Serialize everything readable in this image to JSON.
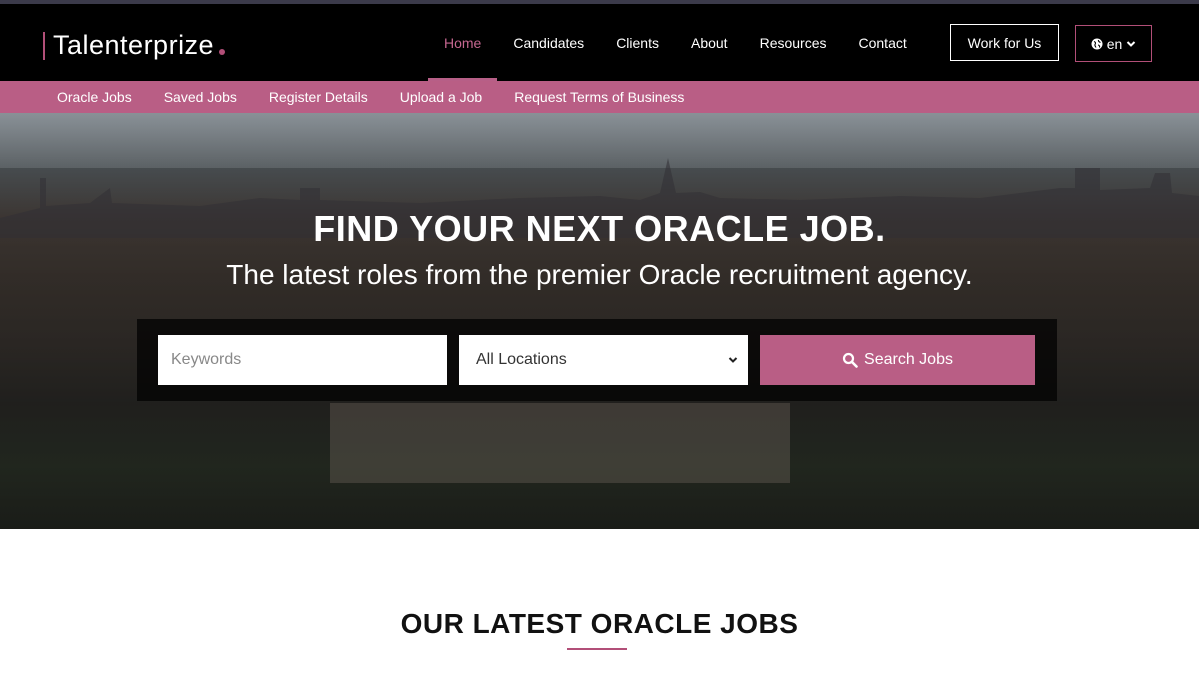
{
  "brand": {
    "name": "Talenterprize",
    "accent": "#b24f78"
  },
  "nav": {
    "items": [
      {
        "label": "Home",
        "active": true
      },
      {
        "label": "Candidates"
      },
      {
        "label": "Clients"
      },
      {
        "label": "About"
      },
      {
        "label": "Resources"
      },
      {
        "label": "Contact"
      }
    ],
    "work_btn": "Work for Us",
    "lang": {
      "icon": "globe-icon",
      "label": "en"
    }
  },
  "subnav": {
    "items": [
      "Oracle Jobs",
      "Saved Jobs",
      "Register Details",
      "Upload a Job",
      "Request Terms of Business"
    ]
  },
  "hero": {
    "title": "FIND YOUR NEXT ORACLE JOB.",
    "subtitle": "The latest roles from the premier Oracle recruitment agency.",
    "search": {
      "keywords_placeholder": "Keywords",
      "location_selected": "All Locations",
      "button_label": "Search Jobs"
    }
  },
  "latest": {
    "title": "OUR LATEST ORACLE JOBS"
  }
}
